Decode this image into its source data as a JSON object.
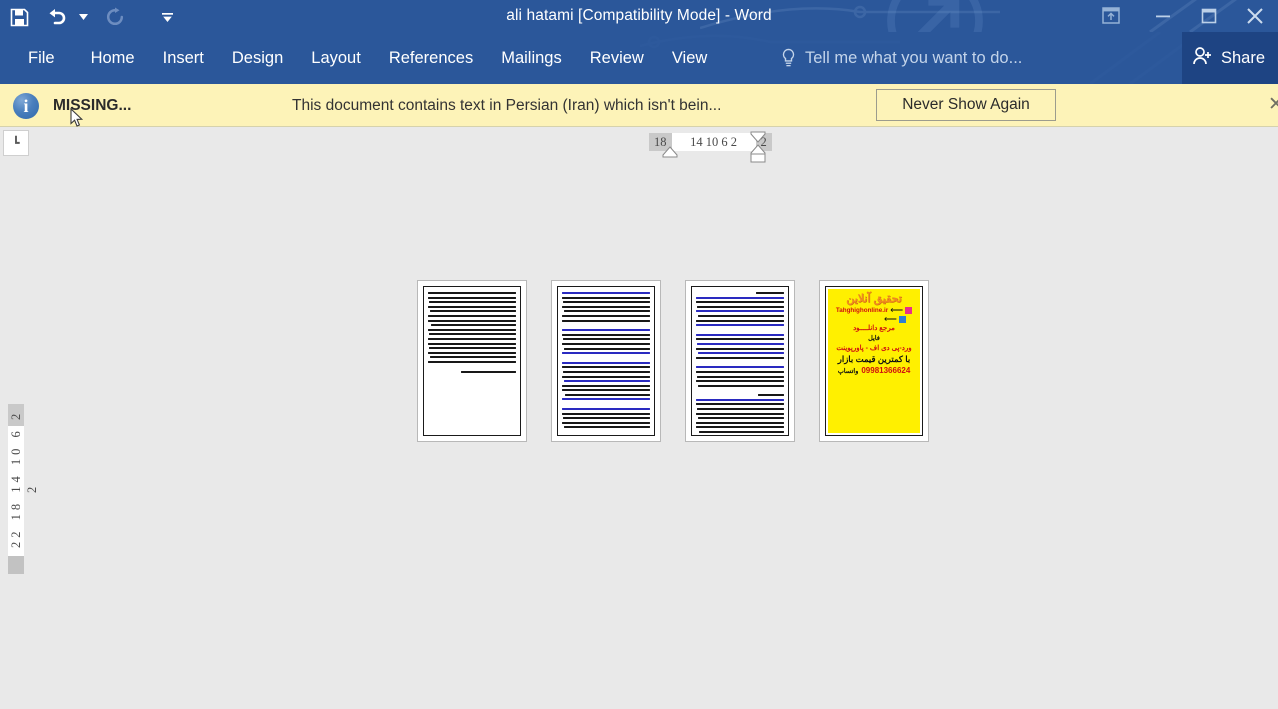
{
  "window": {
    "title": "ali hatami [Compatibility Mode] - Word",
    "quick_access": [
      {
        "name": "save-icon",
        "label": "Save"
      },
      {
        "name": "undo-icon",
        "label": "Undo"
      },
      {
        "name": "undo-dropdown-icon",
        "label": "Undo options"
      },
      {
        "name": "redo-icon",
        "label": "Redo"
      },
      {
        "name": "customize-qat-icon",
        "label": "Customize Quick Access Toolbar"
      }
    ],
    "controls": [
      {
        "name": "ribbon-display-options",
        "label": "Ribbon Display Options",
        "glyph": "⤒"
      },
      {
        "name": "minimize-button",
        "label": "Minimize",
        "glyph": "–"
      },
      {
        "name": "maximize-button",
        "label": "Maximize",
        "glyph": "❐"
      },
      {
        "name": "close-button",
        "label": "Close",
        "glyph": "✕"
      }
    ]
  },
  "ribbon": {
    "tabs": [
      {
        "label": "File"
      },
      {
        "label": "Home"
      },
      {
        "label": "Insert"
      },
      {
        "label": "Design"
      },
      {
        "label": "Layout"
      },
      {
        "label": "References"
      },
      {
        "label": "Mailings"
      },
      {
        "label": "Review"
      },
      {
        "label": "View"
      }
    ],
    "tell_me": "Tell me what you want to do...",
    "share_label": "Share"
  },
  "notification": {
    "title": "MISSING...",
    "message": "This document contains text in Persian (Iran) which isn't bein...",
    "button_label": "Never Show Again",
    "close_glyph": "✕",
    "info_glyph": "i",
    "bg_color": "#fdf3b8"
  },
  "rulers": {
    "corner_glyph": "┗",
    "horizontal": {
      "gray_left": "18",
      "white_numbers": "14  10   6    2",
      "gray_right": "2"
    },
    "vertical": {
      "gray_top": "2",
      "white_numbers": "22 18 14 10  6   2"
    }
  },
  "document": {
    "pages": [
      {
        "name": "page-thumbnail-1",
        "page_number": 1,
        "type": "text"
      },
      {
        "name": "page-thumbnail-2",
        "page_number": 2,
        "type": "text"
      },
      {
        "name": "page-thumbnail-3",
        "page_number": 3,
        "type": "text"
      },
      {
        "name": "page-thumbnail-4",
        "page_number": 4,
        "type": "advertisement"
      }
    ],
    "advertisement": {
      "logo": "تحقیق آنلاین",
      "site": "Tahghighonline.ir",
      "line1": "مرجع دانلــــود",
      "line2": "فایل",
      "line3": "ورد-پی دی اف - پاورپوینت",
      "line4": "با کمترین قیمت بازار",
      "phone": "09981366624",
      "phone_suffix": "واتساپ",
      "bg_color": "#fff000"
    }
  },
  "colors": {
    "word_blue": "#2b579a",
    "share_blue": "#1e4483",
    "canvas_gray": "#e9e9e9",
    "notify_yellow": "#fdf3b8"
  }
}
